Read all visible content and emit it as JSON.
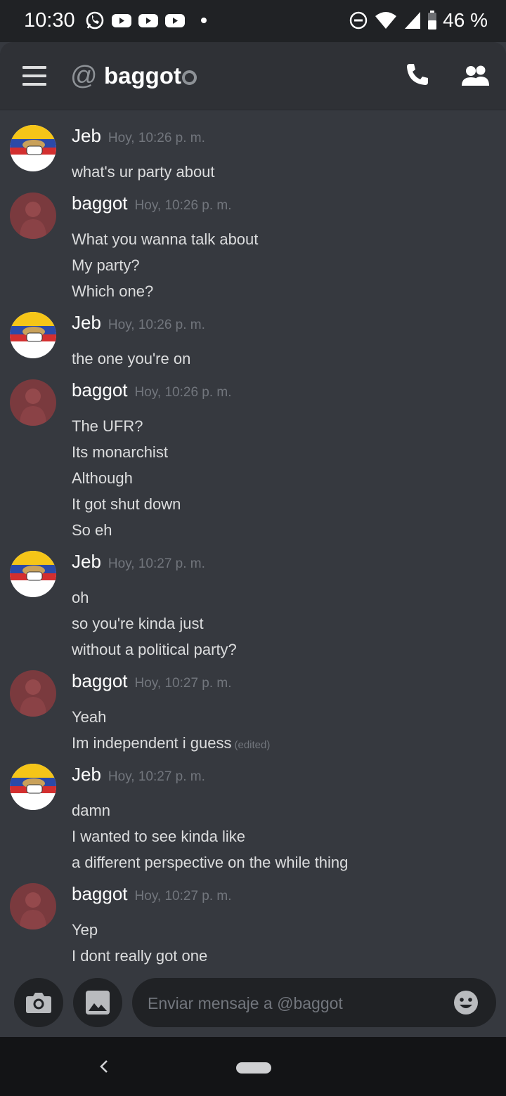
{
  "status_bar": {
    "time": "10:30",
    "battery": "46 %",
    "icons": [
      "whatsapp-icon",
      "youtube-icon",
      "youtube-icon",
      "youtube-icon",
      "notification-dot",
      "do-not-disturb-icon",
      "wifi-icon",
      "signal-icon",
      "battery-icon"
    ]
  },
  "header": {
    "at_symbol": "@",
    "title": "baggot",
    "status": "offline",
    "actions": [
      "call-icon",
      "members-icon"
    ]
  },
  "messages": [
    {
      "author": "Jeb",
      "timestamp": "Hoy, 10:26 p. m.",
      "avatar": "jeb",
      "lines": [
        "what's ur party about"
      ]
    },
    {
      "author": "baggot",
      "timestamp": "Hoy, 10:26 p. m.",
      "avatar": "baggot",
      "lines": [
        "What you wanna talk about",
        "My party?",
        "Which one?"
      ]
    },
    {
      "author": "Jeb",
      "timestamp": "Hoy, 10:26 p. m.",
      "avatar": "jeb",
      "lines": [
        "the one you're on"
      ]
    },
    {
      "author": "baggot",
      "timestamp": "Hoy, 10:26 p. m.",
      "avatar": "baggot",
      "lines": [
        "The UFR?",
        "Its monarchist",
        "Although",
        "It got shut down",
        "So eh"
      ]
    },
    {
      "author": "Jeb",
      "timestamp": "Hoy, 10:27 p. m.",
      "avatar": "jeb",
      "lines": [
        "oh",
        "so you're kinda just",
        "without a political party?"
      ]
    },
    {
      "author": "baggot",
      "timestamp": "Hoy, 10:27 p. m.",
      "avatar": "baggot",
      "lines": [
        "Yeah",
        "Im independent i guess"
      ],
      "edited_label": "(edited)"
    },
    {
      "author": "Jeb",
      "timestamp": "Hoy, 10:27 p. m.",
      "avatar": "jeb",
      "lines": [
        "damn",
        "I wanted to see kinda like",
        "a different perspective on the while thing"
      ]
    },
    {
      "author": "baggot",
      "timestamp": "Hoy, 10:27 p. m.",
      "avatar": "baggot",
      "lines": [
        "Yep",
        "I dont really got one"
      ]
    }
  ],
  "composer": {
    "placeholder": "Enviar mensaje a @baggot",
    "value": "",
    "buttons": [
      "camera-icon",
      "gallery-icon",
      "emoji-icon"
    ]
  },
  "colors": {
    "background": "#36393f",
    "header": "#2f3136",
    "text": "#dcddde",
    "muted": "#72767d",
    "accent": "#7289da"
  }
}
